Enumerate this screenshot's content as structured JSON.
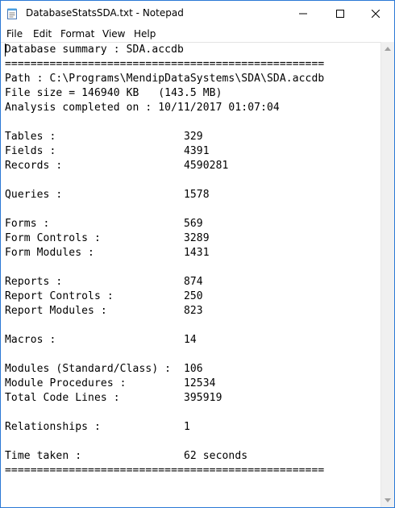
{
  "window": {
    "title": "DatabaseStatsSDA.txt - Notepad"
  },
  "menu": [
    "File",
    "Edit",
    "Format",
    "View",
    "Help"
  ],
  "lines": [
    "Database summary : SDA.accdb",
    "==================================================",
    "Path : C:\\Programs\\MendipDataSystems\\SDA\\SDA.accdb",
    "File size = 146940 KB   (143.5 MB)",
    "Analysis completed on : 10/11/2017 01:07:04",
    "",
    "Tables :                    329",
    "Fields :                    4391",
    "Records :                   4590281",
    "",
    "Queries :                   1578",
    "",
    "Forms :                     569",
    "Form Controls :             3289",
    "Form Modules :              1431",
    "",
    "Reports :                   874",
    "Report Controls :           250",
    "Report Modules :            823",
    "",
    "Macros :                    14",
    "",
    "Modules (Standard/Class) :  106",
    "Module Procedures :         12534",
    "Total Code Lines :          395919",
    "",
    "Relationships :             1",
    "",
    "Time taken :                62 seconds",
    "=================================================="
  ]
}
